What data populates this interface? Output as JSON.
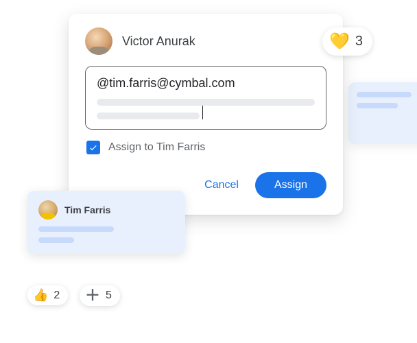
{
  "card": {
    "author": "Victor Anurak",
    "mention": "@tim.farris@cymbal.com",
    "assign_label": "Assign to Tim Farris",
    "cancel_label": "Cancel",
    "assign_button": "Assign"
  },
  "reactions": {
    "heart_count": "3",
    "thumb_count": "2",
    "plus_count": "5"
  },
  "mini_card": {
    "name": "Tim Farris"
  }
}
